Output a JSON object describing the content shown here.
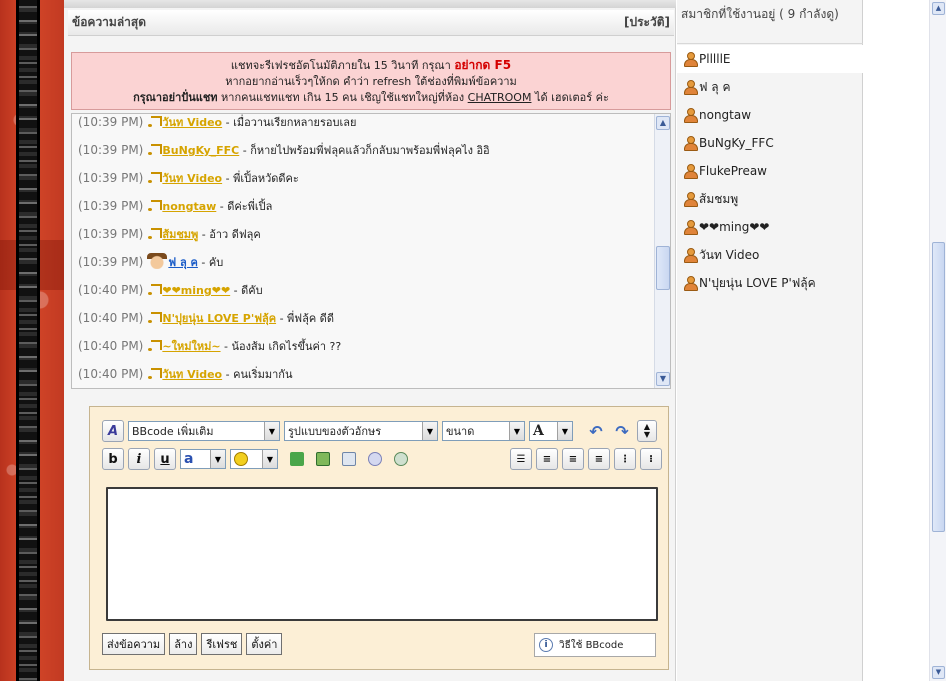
{
  "chat": {
    "title": "ข้อความล่าสุด",
    "history_link": "[ประวัติ]",
    "notice": {
      "line1_prefix": "แชทจะรีเฟรชอัตโนมัติภายใน 15 วินาที กรุณา ",
      "line1_strong": "อย่ากด F5",
      "line2": "หากอยากอ่านเร็วๆให้กด คำว่า refresh ใต้ช่องที่พิมพ์ข้อความ",
      "line3_strong": "กรุณาอย่าปั่นแชท",
      "line3_middle": " หากคนแชทแชท เกิน 15 คน เชิญใช้แชทใหญ่ที่ห้อง ",
      "line3_link": "CHATROOM",
      "line3_suffix": " ได้ เฮดเตอร์ ค่ะ"
    },
    "messages": [
      {
        "time": "(10:39 PM)",
        "nick": "วันท Video",
        "text": " - เมื่อวานเรียกหลายรอบเลย"
      },
      {
        "time": "(10:39 PM)",
        "nick": "BuNgKy_FFC",
        "text": " - ก็หายไปพร้อมพี่ฟลุคแล้วก็กลับมาพร้อมพี่ฟลุคไง อิอิ"
      },
      {
        "time": "(10:39 PM)",
        "nick": "วันท Video",
        "text": " - พี่เปิ้ลหวัดดีคะ"
      },
      {
        "time": "(10:39 PM)",
        "nick": "nongtaw",
        "text": " - ดีค่ะพี่เปิ้ล"
      },
      {
        "time": "(10:39 PM)",
        "nick": "ส้มชมพู",
        "text": " - อ้าว ดีฟลุค"
      },
      {
        "time": "(10:39 PM)",
        "nick": "ฟ ลุ ค",
        "text": " - คับ",
        "special": true
      },
      {
        "time": "(10:40 PM)",
        "nick": "❤❤ming❤❤",
        "text": " - ดีคับ"
      },
      {
        "time": "(10:40 PM)",
        "nick": "N'ปุยนุ่น LOVE P'ฟลุ้ค",
        "text": " - พี่ฟลุ้ค ดีดี"
      },
      {
        "time": "(10:40 PM)",
        "nick": "~ใหม่ใหม่~",
        "text": " - น้องส้ม เกิดไรขึ้นค่า ??"
      },
      {
        "time": "(10:40 PM)",
        "nick": "วันท Video",
        "text": " - คนเริ่มมากัน"
      }
    ]
  },
  "composer": {
    "bbcode_select": "BBcode เพิ่มเติม",
    "font_select": "รูปแบบของตัวอักษร",
    "size_select": "ขนาด",
    "font_color_label": "A",
    "bold_label": "b",
    "italic_label": "i",
    "underline_label": "u",
    "highlight_label": "a",
    "message_value": "",
    "send_label": "ส่งข้อความ",
    "clear_label": "ล้าง",
    "refresh_label": "รีเฟรช",
    "settings_label": "ตั้งค่า",
    "help_label": "วิธีใช้ BBcode"
  },
  "online": {
    "title": "สมาชิกที่ใช้งานอยู่ ( 9 กำลังดู)",
    "members": [
      "PlllllE",
      "ฟ ลุ ค",
      "nongtaw",
      "BuNgKy_FFC",
      "FlukePreaw",
      "ส้มชมพู",
      "❤❤ming❤❤",
      "วันท Video",
      "N'ปุยนุ่น LOVE P'ฟลุ้ค"
    ]
  }
}
